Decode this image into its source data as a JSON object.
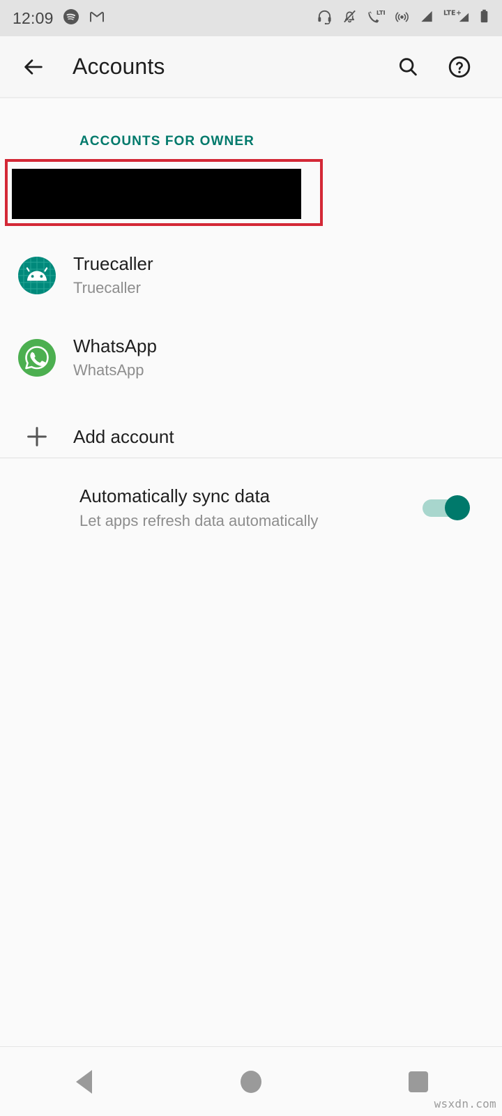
{
  "status_bar": {
    "time": "12:09",
    "left_icons": [
      "spotify-icon",
      "gmail-icon"
    ],
    "right_icons": [
      "headset-icon",
      "notifications-off-icon",
      "volte-call-icon",
      "hotspot-icon",
      "signal-bars-icon",
      "lte-plus-signal-icon",
      "battery-icon"
    ],
    "background": "#e3e3e3"
  },
  "app_bar": {
    "back_label": "back-arrow",
    "title": "Accounts",
    "search_label": "search",
    "help_label": "help",
    "background": "#f7f7f7"
  },
  "content": {
    "section_header": "ACCOUNTS FOR OWNER",
    "accent_color": "#00796b",
    "redacted_account": {
      "name": "redacted-account-row",
      "annotation_color": "#d32836",
      "redaction_color": "#000000"
    },
    "accounts": [
      {
        "title": "Truecaller",
        "subtitle": "Truecaller",
        "icon": "truecaller-android-icon",
        "icon_color": "#00897b"
      },
      {
        "title": "WhatsApp",
        "subtitle": "WhatsApp",
        "icon": "whatsapp-icon",
        "icon_color": "#4caf50"
      }
    ],
    "add_account": {
      "label": "Add account",
      "icon": "plus-icon"
    },
    "sync": {
      "title": "Automatically sync data",
      "subtitle": "Let apps refresh data automatically",
      "toggle_state": "on",
      "toggle_track_color": "#a8d6cd",
      "toggle_thumb_color": "#00796b"
    }
  },
  "nav_bar": {
    "back": "back-triangle",
    "home": "home-circle",
    "recents": "recents-square",
    "icon_color": "#9a9a9a"
  },
  "watermark": "wsxdn.com"
}
